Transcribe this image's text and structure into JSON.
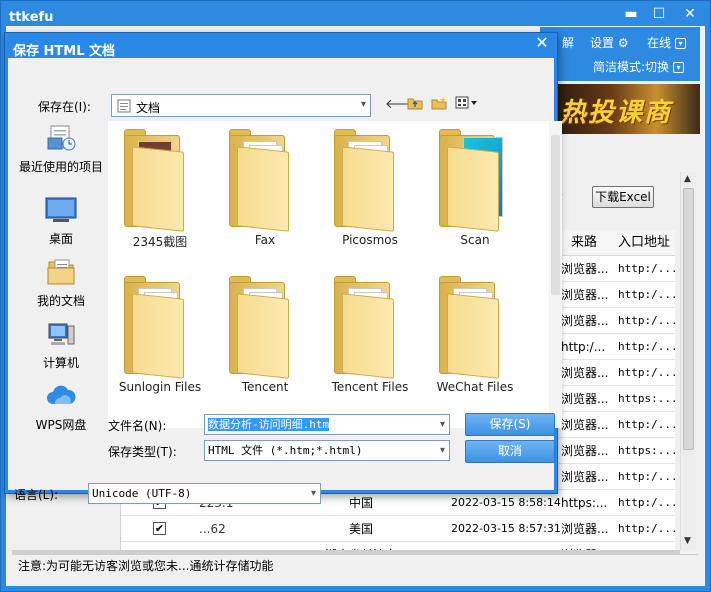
{
  "app": {
    "title": "ttkefu",
    "minimize_glyph": "▬",
    "maximize_glyph": "☐",
    "close_glyph": "✕",
    "topbar": {
      "partial_label": "解",
      "settings_label": "设置",
      "online_label": "在线",
      "simple_mode_label": "简洁模式:切换"
    },
    "banner_text": "热投课商",
    "excel_button_label": "下载Excel",
    "table": {
      "headers": [
        "来路",
        "入口地址"
      ],
      "rows": [
        {
          "source": "浏览器...",
          "entry": "http:/..."
        },
        {
          "source": "浏览器...",
          "entry": "http:/..."
        },
        {
          "source": "浏览器...",
          "entry": "http:/..."
        },
        {
          "source": "http:/...",
          "entry": "http:/..."
        },
        {
          "source": "浏览器...",
          "entry": "http:/..."
        },
        {
          "source": "浏览器...",
          "entry": "https:..."
        },
        {
          "source": "浏览器...",
          "entry": "http:/..."
        },
        {
          "source": "浏览器...",
          "entry": "https:..."
        },
        {
          "source": "浏览器...",
          "entry": "http:/..."
        },
        {
          "ip": "223.1",
          "country": "中国",
          "time": "2022-03-15 8:58:14",
          "source": "https:...",
          "entry": "http:/...",
          "checked": true
        },
        {
          "ip": "...62",
          "country": "美国",
          "time": "2022-03-15 8:57:31",
          "source": "浏览器...",
          "entry": "http:/...",
          "checked": true
        },
        {
          "country": "湖南省长沙市",
          "source": "浏览器...",
          "entry": "http:/..."
        }
      ]
    },
    "status_text": "注意:为可能无访客浏览或您未...通统计存储功能"
  },
  "dialog": {
    "title": "保存 HTML 文档",
    "close_glyph": "✕",
    "save_in_label": "保存在(I):",
    "save_in_value": "文档",
    "places": [
      {
        "label": "最近使用的项目",
        "icon": "recent-icon"
      },
      {
        "label": "桌面",
        "icon": "desktop-icon"
      },
      {
        "label": "我的文档",
        "icon": "documents-icon"
      },
      {
        "label": "计算机",
        "icon": "computer-icon"
      },
      {
        "label": "WPS网盘",
        "icon": "cloud-icon"
      }
    ],
    "folders": [
      {
        "name": "2345截图"
      },
      {
        "name": "Fax"
      },
      {
        "name": "Picosmos"
      },
      {
        "name": "Scan"
      },
      {
        "name": "Sunlogin Files"
      },
      {
        "name": "Tencent"
      },
      {
        "name": "Tencent Files"
      },
      {
        "name": "WeChat Files"
      }
    ],
    "filename_label": "文件名(N):",
    "filename_value": "数据分析-访问明细.htm",
    "filetype_label": "保存类型(T):",
    "filetype_value": "HTML 文件 (*.htm;*.html)",
    "language_label": "语言(L):",
    "language_value": "Unicode (UTF-8)",
    "save_button": "保存(S)",
    "cancel_button": "取消"
  }
}
